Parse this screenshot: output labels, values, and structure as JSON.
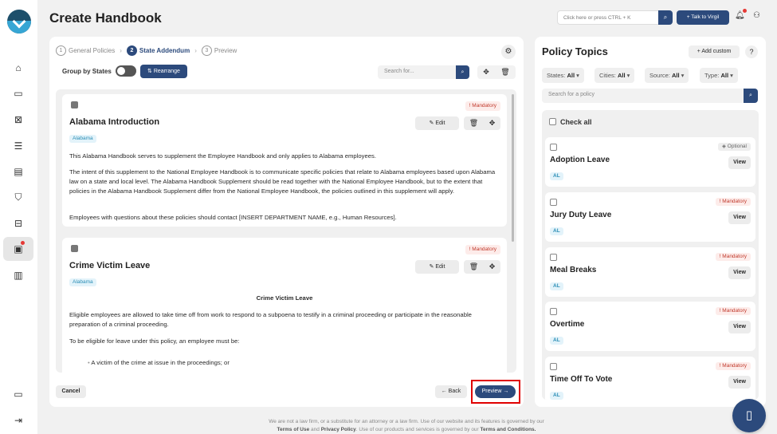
{
  "sidebar": {
    "icons": [
      "home-icon",
      "chat-icon",
      "document-icon",
      "checklist-icon",
      "file-icon",
      "shield-icon",
      "compare-icon",
      "handbook-icon",
      "analytics-icon",
      "feedback-icon",
      "logout-icon"
    ]
  },
  "header": {
    "title": "Create Handbook",
    "search_placeholder": "Click here or press CTRL + K",
    "virgil_label": "+ Talk to Virgil"
  },
  "steps": [
    {
      "num": "1",
      "label": "General Policies"
    },
    {
      "num": "2",
      "label": "State Addendum"
    },
    {
      "num": "3",
      "label": "Preview"
    }
  ],
  "toolbar": {
    "group_label": "Group by States",
    "rearrange_label": "⇅ Rearrange",
    "search_placeholder": "Search for..."
  },
  "cards": [
    {
      "badge": "! Mandatory",
      "title": "Alabama Introduction",
      "tag": "Alabama",
      "edit_label": "Edit",
      "paragraphs": [
        "This Alabama Handbook serves to supplement the Employee Handbook and only applies to Alabama employees.",
        "The intent of this supplement to the National Employee Handbook is to communicate specific policies that relate to Alabama employees based upon Alabama law on a state and local level. The Alabama Handbook Supplement should be read together with the National Employee Handbook, but to the extent that policies in the Alabama Handbook Supplement differ from the National Employee Handbook, the policies outlined in this supplement will apply.",
        "Employees with questions about these policies should contact [INSERT DEPARTMENT NAME, e.g., Human Resources]."
      ]
    },
    {
      "badge": "! Mandatory",
      "title": "Crime Victim Leave",
      "tag": "Alabama",
      "edit_label": "Edit",
      "heading": "Crime Victim Leave",
      "paragraphs": [
        "Eligible employees are allowed to take time off from work to respond to a subpoena to testify in a criminal proceeding or participate in the reasonable preparation of a criminal proceeding.",
        "To be eligible for leave under this policy, an employee must be:"
      ],
      "bullet": "A victim of the crime at issue in the proceedings; or"
    }
  ],
  "footer_buttons": {
    "cancel": "Cancel",
    "back": "← Back",
    "preview": "Preview →"
  },
  "policy_panel": {
    "title": "Policy Topics",
    "add_custom": "+ Add custom",
    "filters": [
      {
        "label": "States:",
        "value": "All"
      },
      {
        "label": "Cities:",
        "value": "All"
      },
      {
        "label": "Source:",
        "value": "All"
      },
      {
        "label": "Type:",
        "value": "All"
      }
    ],
    "search_placeholder": "Search for a policy",
    "check_all": "Check all",
    "view_label": "View",
    "items": [
      {
        "name": "Adoption Leave",
        "badge": "Optional",
        "tag": "AL"
      },
      {
        "name": "Jury Duty Leave",
        "badge": "! Mandatory",
        "tag": "AL"
      },
      {
        "name": "Meal Breaks",
        "badge": "! Mandatory",
        "tag": "AL"
      },
      {
        "name": "Overtime",
        "badge": "! Mandatory",
        "tag": "AL"
      },
      {
        "name": "Time Off To Vote",
        "badge": "! Mandatory",
        "tag": "AL"
      }
    ]
  },
  "footer": {
    "line1": "We are not a law firm, or a substitute for an attorney or a law firm. Use of our website and its features is governed by our",
    "terms_of_use": "Terms of Use",
    "and": "and",
    "privacy": "Privacy Policy",
    "line2_mid": ". Use of our products and services is governed by our",
    "terms_conditions": "Terms and Conditions."
  },
  "colors": {
    "primary": "#2c4a7c",
    "mandatory": "#c0392b",
    "highlight": "#e00000"
  }
}
